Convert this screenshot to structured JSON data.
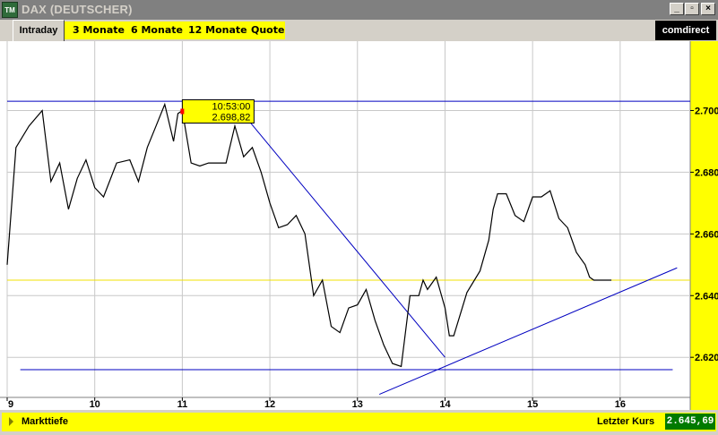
{
  "window": {
    "app_icon": "TM",
    "title": "DAX (DEUTSCHER)",
    "buttons": {
      "minimize": "_",
      "restore": "▫",
      "close": "×"
    }
  },
  "tabs": {
    "active": "Intraday",
    "items": [
      "3 Monate",
      "6 Monate",
      "12 Monate",
      "Quote"
    ]
  },
  "brand": "comdirect",
  "tooltip": {
    "time": "10:53:00",
    "value": "2.698,82"
  },
  "bottom": {
    "depth_label": "Markttiefe",
    "last_label": "Letzter Kurs",
    "last_value": "2.645,69"
  },
  "colors": {
    "accent": "#ffff00",
    "price_line": "#000000",
    "trend_line": "#0000c0",
    "last_line": "#f0e000",
    "last_box": "#007a00"
  },
  "chart_data": {
    "type": "line",
    "x": [
      9.0,
      9.1,
      9.25,
      9.4,
      9.5,
      9.6,
      9.7,
      9.8,
      9.9,
      10.0,
      10.1,
      10.25,
      10.4,
      10.5,
      10.6,
      10.7,
      10.8,
      10.9,
      10.95,
      11.0,
      11.1,
      11.2,
      11.3,
      11.5,
      11.6,
      11.7,
      11.8,
      11.9,
      12.0,
      12.1,
      12.2,
      12.3,
      12.4,
      12.5,
      12.6,
      12.7,
      12.8,
      12.9,
      13.0,
      13.1,
      13.2,
      13.3,
      13.4,
      13.5,
      13.6,
      13.7,
      13.75,
      13.8,
      13.9,
      14.0,
      14.05,
      14.1,
      14.25,
      14.4,
      14.5,
      14.55,
      14.6,
      14.7,
      14.8,
      14.9,
      15.0,
      15.1,
      15.2,
      15.3,
      15.4,
      15.5,
      15.6,
      15.65,
      15.7,
      15.8,
      15.9
    ],
    "y": [
      2650,
      2688,
      2695,
      2700,
      2677,
      2683,
      2668,
      2678,
      2684,
      2675,
      2672,
      2683,
      2684,
      2677,
      2688,
      2695,
      2702,
      2690,
      2699,
      2700,
      2683,
      2682,
      2683,
      2683,
      2695,
      2685,
      2688,
      2680,
      2670,
      2662,
      2663,
      2666,
      2660,
      2640,
      2645,
      2630,
      2628,
      2636,
      2637,
      2642,
      2632,
      2624,
      2618,
      2617,
      2640,
      2640,
      2645,
      2642,
      2646,
      2636,
      2627,
      2627,
      2641,
      2648,
      2658,
      2668,
      2673,
      2673,
      2666,
      2664,
      2672,
      2672,
      2674,
      2665,
      2662,
      2654,
      2650,
      2646,
      2645,
      2645,
      2645
    ],
    "xlim": [
      9,
      16.8
    ],
    "ylim": [
      2607,
      2719
    ],
    "x_ticks": [
      "9",
      "10",
      "11",
      "12",
      "13",
      "14",
      "15",
      "16"
    ],
    "x_tick_values": [
      9,
      10,
      11,
      12,
      13,
      14,
      15,
      16
    ],
    "y_ticks": [
      "2.620",
      "2.640",
      "2.660",
      "2.680",
      "2.700"
    ],
    "y_tick_values": [
      2620,
      2640,
      2660,
      2680,
      2700
    ],
    "annotations": {
      "resistance": {
        "x": [
          9.0,
          16.8
        ],
        "y": [
          2703,
          2703
        ]
      },
      "support": {
        "x": [
          9.15,
          16.6
        ],
        "y": [
          2616,
          2616
        ]
      },
      "downtrend": {
        "x": [
          11.75,
          14.0
        ],
        "y": [
          2697,
          2620
        ]
      },
      "uptrend": {
        "x": [
          13.25,
          16.65
        ],
        "y": [
          2608,
          2649
        ]
      },
      "last_line": {
        "y": 2645
      }
    },
    "grid": true
  }
}
